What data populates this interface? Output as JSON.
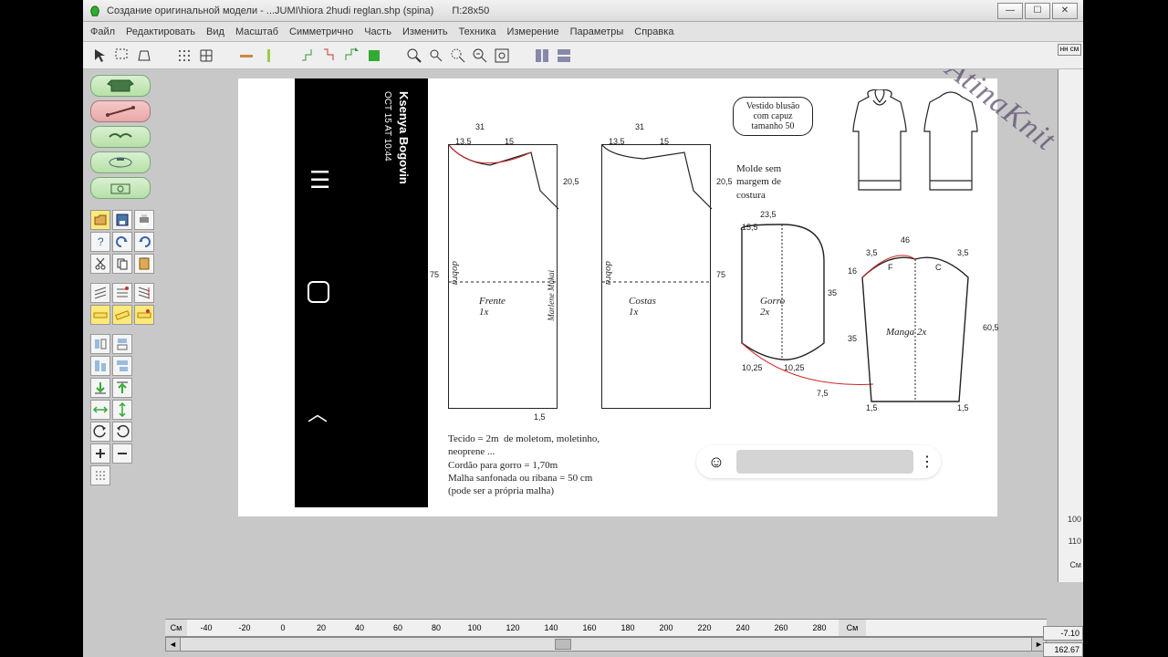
{
  "window": {
    "title": "Создание оригинальной модели - ...JUMI\\hiora 2hudi reglan.shp (spina)",
    "param": "П:28x50"
  },
  "menu": [
    "Файл",
    "Редактировать",
    "Вид",
    "Масштаб",
    "Симметрично",
    "Часть",
    "Изменить",
    "Техника",
    "Измерение",
    "Параметры",
    "Справка"
  ],
  "watermark": "AtinaKnit",
  "author": {
    "name": "Ksenya Bogovin",
    "time": "OCT 15 AT 10:44"
  },
  "diagram": {
    "bubble": "Vestido blusão\ncom capuz\ntamanho 50",
    "molde": "Molde sem\nmargem de\ncostura",
    "front": {
      "label": "Frente\n1x",
      "w": "31",
      "shoulder": "13,5",
      "neck": "15",
      "side": "20,5",
      "len": "75"
    },
    "back": {
      "label": "Costas\n1x",
      "w": "31",
      "shoulder": "13,5",
      "neck": "15",
      "side": "20,5",
      "len": "75"
    },
    "hood": {
      "label": "Gorro\n2x",
      "w": "23,5",
      "half": "15,5",
      "h": "35",
      "bottom_l": "10,25",
      "bottom_r": "10,25",
      "tip": "7,5"
    },
    "sleeve": {
      "label": "Manga 2x",
      "w": "46",
      "half_l": "3,5",
      "half_r": "3,5",
      "cap": "16",
      "len": "60,5",
      "side": "35",
      "hem_l": "1,5",
      "hem_r": "1,5"
    },
    "fabric_notes": "Tecido = 2m  de moletom, moletinho,\nneoprene ...\nCordão para gorro = 1,70m\nMalha sanfonada ou ribana = 50 cm\n(pode ser a própria malha)",
    "front_author": "Marlene Mukai",
    "dobra": "dobra"
  },
  "hruler": {
    "unit": "См",
    "ticks": [
      "-40",
      "-20",
      "0",
      "20",
      "40",
      "60",
      "80",
      "100",
      "120",
      "140",
      "160",
      "180",
      "200",
      "220",
      "240",
      "260",
      "280"
    ]
  },
  "vruler": {
    "ticks": [
      "100",
      "110"
    ],
    "unit": "См"
  },
  "coords": {
    "x": "-7.10",
    "y": "162.67"
  },
  "unitbox": "нн\nсм"
}
